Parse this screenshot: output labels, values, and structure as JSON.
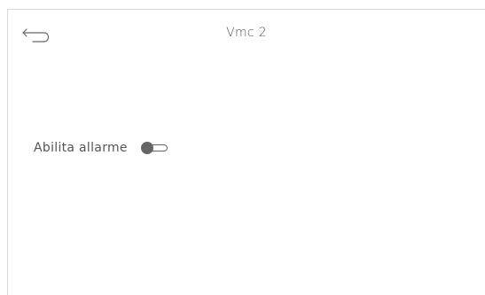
{
  "header": {
    "title": "Vmc 2",
    "back_icon": "back-arrow-icon"
  },
  "settings": {
    "alarm": {
      "label": "Abilita allarme",
      "enabled": false
    }
  },
  "colors": {
    "text": "#555555",
    "toggle": "#666666",
    "border": "#d9d9d9",
    "background": "#ffffff"
  }
}
